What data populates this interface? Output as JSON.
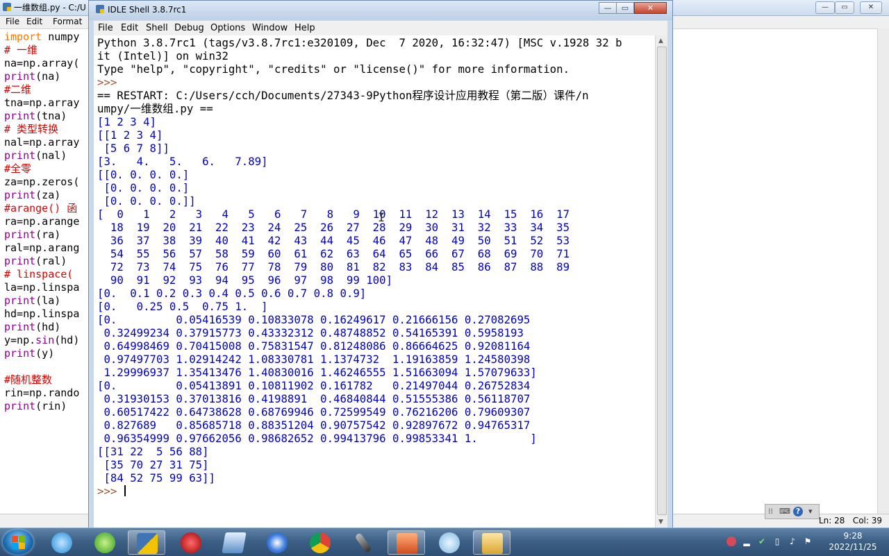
{
  "editor": {
    "title": "一维数组.py - C:/U",
    "menus": [
      "File",
      "Edit",
      "Format"
    ],
    "status": {
      "line": "Ln: 28",
      "col": "Col: 39"
    },
    "code_lines": [
      [
        {
          "t": "kw",
          "s": "import"
        },
        {
          "t": "df",
          "s": " numpy"
        }
      ],
      [
        {
          "t": "cm",
          "s": "# 一维"
        }
      ],
      [
        {
          "t": "df",
          "s": "na=np.array("
        }
      ],
      [
        {
          "t": "bi",
          "s": "print"
        },
        {
          "t": "df",
          "s": "(na)"
        }
      ],
      [
        {
          "t": "cm",
          "s": "#二维"
        }
      ],
      [
        {
          "t": "df",
          "s": "tna=np.array"
        }
      ],
      [
        {
          "t": "bi",
          "s": "print"
        },
        {
          "t": "df",
          "s": "(tna)"
        }
      ],
      [
        {
          "t": "cm",
          "s": "# 类型转换"
        }
      ],
      [
        {
          "t": "df",
          "s": "nal=np.array"
        }
      ],
      [
        {
          "t": "bi",
          "s": "print"
        },
        {
          "t": "df",
          "s": "(nal)"
        }
      ],
      [
        {
          "t": "cm",
          "s": "#全零"
        }
      ],
      [
        {
          "t": "df",
          "s": "za=np.zeros("
        }
      ],
      [
        {
          "t": "bi",
          "s": "print"
        },
        {
          "t": "df",
          "s": "(za)"
        }
      ],
      [
        {
          "t": "cm",
          "s": "#arange() 函"
        }
      ],
      [
        {
          "t": "df",
          "s": "ra=np.arange"
        }
      ],
      [
        {
          "t": "bi",
          "s": "print"
        },
        {
          "t": "df",
          "s": "(ra)"
        }
      ],
      [
        {
          "t": "df",
          "s": "ral=np.arang"
        }
      ],
      [
        {
          "t": "bi",
          "s": "print"
        },
        {
          "t": "df",
          "s": "(ral)"
        }
      ],
      [
        {
          "t": "cm",
          "s": "# linspace("
        }
      ],
      [
        {
          "t": "df",
          "s": "la=np.linspa"
        }
      ],
      [
        {
          "t": "bi",
          "s": "print"
        },
        {
          "t": "df",
          "s": "(la)"
        }
      ],
      [
        {
          "t": "df",
          "s": "hd=np.linspa"
        }
      ],
      [
        {
          "t": "bi",
          "s": "print"
        },
        {
          "t": "df",
          "s": "(hd)"
        }
      ],
      [
        {
          "t": "df",
          "s": "y=np."
        },
        {
          "t": "bi",
          "s": "sin"
        },
        {
          "t": "df",
          "s": "(hd)"
        }
      ],
      [
        {
          "t": "bi",
          "s": "print"
        },
        {
          "t": "df",
          "s": "(y)"
        }
      ],
      [
        {
          "t": "df",
          "s": ""
        }
      ],
      [
        {
          "t": "cm",
          "s": "#随机整数"
        }
      ],
      [
        {
          "t": "df",
          "s": "rin=np.rando"
        }
      ],
      [
        {
          "t": "bi",
          "s": "print"
        },
        {
          "t": "df",
          "s": "(rin)"
        }
      ]
    ]
  },
  "shell": {
    "title": "IDLE Shell 3.8.7rc1",
    "menus": [
      "File",
      "Edit",
      "Shell",
      "Debug",
      "Options",
      "Window",
      "Help"
    ],
    "window_buttons": {
      "minimize": "—",
      "maximize": "▭",
      "close": "✕"
    },
    "lines": [
      {
        "c": "banner",
        "t": "Python 3.8.7rc1 (tags/v3.8.7rc1:e320109, Dec  7 2020, 16:32:47) [MSC v.1928 32 b"
      },
      {
        "c": "banner",
        "t": "it (Intel)] on win32"
      },
      {
        "c": "banner",
        "t": "Type \"help\", \"copyright\", \"credits\" or \"license()\" for more information."
      },
      {
        "c": "prompt",
        "t": ">>> "
      },
      {
        "c": "restart",
        "t": "== RESTART: C:/Users/cch/Documents/27343-9Python程序设计应用教程（第二版）课件/n"
      },
      {
        "c": "restart",
        "t": "umpy/一维数组.py =="
      },
      {
        "c": "out",
        "t": "[1 2 3 4]"
      },
      {
        "c": "out",
        "t": "[[1 2 3 4]"
      },
      {
        "c": "out",
        "t": " [5 6 7 8]]"
      },
      {
        "c": "out",
        "t": "[3.   4.   5.   6.   7.89]"
      },
      {
        "c": "out",
        "t": "[[0. 0. 0. 0.]"
      },
      {
        "c": "out",
        "t": " [0. 0. 0. 0.]"
      },
      {
        "c": "out",
        "t": " [0. 0. 0. 0.]]"
      },
      {
        "c": "out",
        "t": "[  0   1   2   3   4   5   6   7   8   9  10  11  12  13  14  15  16  17"
      },
      {
        "c": "out",
        "t": "  18  19  20  21  22  23  24  25  26  27  28  29  30  31  32  33  34  35"
      },
      {
        "c": "out",
        "t": "  36  37  38  39  40  41  42  43  44  45  46  47  48  49  50  51  52  53"
      },
      {
        "c": "out",
        "t": "  54  55  56  57  58  59  60  61  62  63  64  65  66  67  68  69  70  71"
      },
      {
        "c": "out",
        "t": "  72  73  74  75  76  77  78  79  80  81  82  83  84  85  86  87  88  89"
      },
      {
        "c": "out",
        "t": "  90  91  92  93  94  95  96  97  98  99 100]"
      },
      {
        "c": "out",
        "t": "[0.  0.1 0.2 0.3 0.4 0.5 0.6 0.7 0.8 0.9]"
      },
      {
        "c": "out",
        "t": "[0.   0.25 0.5  0.75 1.  ]"
      },
      {
        "c": "out",
        "t": "[0.         0.05416539 0.10833078 0.16249617 0.21666156 0.27082695"
      },
      {
        "c": "out",
        "t": " 0.32499234 0.37915773 0.43332312 0.48748852 0.54165391 0.5958193"
      },
      {
        "c": "out",
        "t": " 0.64998469 0.70415008 0.75831547 0.81248086 0.86664625 0.92081164"
      },
      {
        "c": "out",
        "t": " 0.97497703 1.02914242 1.08330781 1.1374732  1.19163859 1.24580398"
      },
      {
        "c": "out",
        "t": " 1.29996937 1.35413476 1.40830016 1.46246555 1.51663094 1.57079633]"
      },
      {
        "c": "out",
        "t": "[0.         0.05413891 0.10811902 0.161782   0.21497044 0.26752834"
      },
      {
        "c": "out",
        "t": " 0.31930153 0.37013816 0.4198891  0.46840844 0.51555386 0.56118707"
      },
      {
        "c": "out",
        "t": " 0.60517422 0.64738628 0.68769946 0.72599549 0.76216206 0.79609307"
      },
      {
        "c": "out",
        "t": " 0.827689   0.85685718 0.88351204 0.90757542 0.92897672 0.94765317"
      },
      {
        "c": "out",
        "t": " 0.96354999 0.97662056 0.98682652 0.99413796 0.99853341 1.        ]"
      },
      {
        "c": "out",
        "t": "[[31 22  5 56 88]"
      },
      {
        "c": "out",
        "t": " [35 70 27 31 75]"
      },
      {
        "c": "out",
        "t": " [84 52 75 99 63]]"
      },
      {
        "c": "prompt",
        "t": ">>> "
      }
    ]
  },
  "taskbar": {
    "time": "9:28",
    "date": "2022/11/25",
    "apps": [
      "start-button",
      "internet-explorer-icon",
      "browser-e-icon",
      "python-idle-icon",
      "media-player-icon",
      "notebook-icon",
      "graphics-app-icon",
      "chrome-icon",
      "microphone-icon",
      "presentation-app-icon",
      "network-app-icon",
      "folder-icon"
    ]
  },
  "ime": {
    "help": "?"
  }
}
